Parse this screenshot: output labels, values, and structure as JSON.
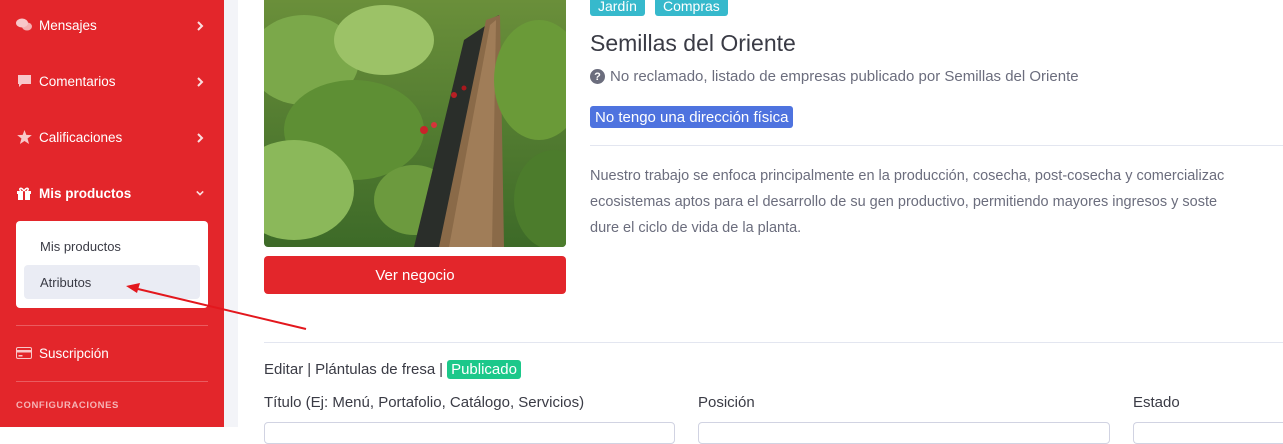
{
  "sidebar": {
    "items": [
      {
        "label": "Mensajes",
        "icon": "comments-icon"
      },
      {
        "label": "Comentarios",
        "icon": "comment-icon"
      },
      {
        "label": "Calificaciones",
        "icon": "star-icon"
      },
      {
        "label": "Mis productos",
        "icon": "gift-icon"
      },
      {
        "label": "Suscripción",
        "icon": "credit-card-icon"
      }
    ],
    "submenu": [
      {
        "label": "Mis productos"
      },
      {
        "label": "Atributos"
      }
    ],
    "section_heading": "CONFIGURACIONES"
  },
  "listing": {
    "tags": [
      "Jardín",
      "Compras"
    ],
    "title": "Semillas del Oriente",
    "status_text": "No reclamado, listado de empresas publicado por Semillas del Oriente",
    "address_badge": "No tengo una dirección física",
    "description_lines": [
      "Nuestro trabajo se enfoca principalmente en la producción, cosecha, post-cosecha y comercializac",
      "ecosistemas aptos para el desarrollo de su gen productivo, permitiendo mayores ingresos y soste",
      "dure el ciclo de vida de la planta."
    ],
    "view_button": "Ver negocio"
  },
  "product": {
    "edit_link": "Editar",
    "separator": "|",
    "name": "Plántulas de fresa",
    "status": "Publicado"
  },
  "form": {
    "labels": [
      "Título (Ej: Menú, Portafolio, Catálogo, Servicios)",
      "Posición",
      "Estado"
    ]
  },
  "colors": {
    "sidebar": "#e3262b",
    "tag": "#36b9cc",
    "badge_blue": "#4e73df",
    "badge_green": "#1cc88a"
  }
}
